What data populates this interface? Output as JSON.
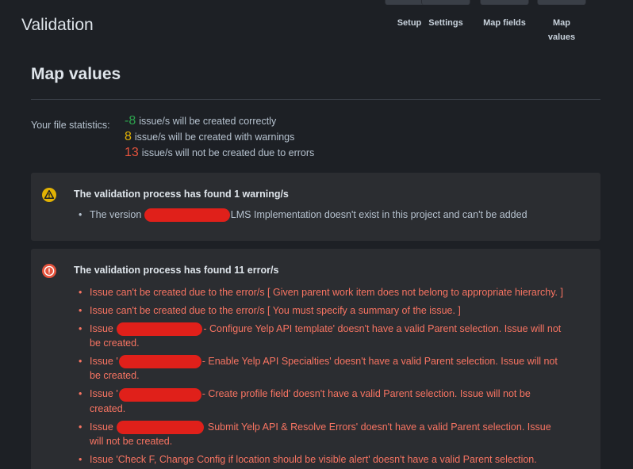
{
  "header": {
    "title": "Validation",
    "steps": [
      {
        "label": "Setup"
      },
      {
        "label": "Settings"
      },
      {
        "label": "Map fields"
      },
      {
        "label": "Map values"
      }
    ]
  },
  "section": {
    "title": "Map values"
  },
  "stats": {
    "label": "Your file statistics:",
    "correct_count": "-8",
    "correct_text": "issue/s will be created correctly",
    "warning_count": "8",
    "warning_text": "issue/s will be created with warnings",
    "error_count": "13",
    "error_text": "issue/s will not be created due to errors"
  },
  "warnings": {
    "title": "The validation process has found 1 warning/s",
    "items": [
      {
        "before": "The version",
        "after": "LMS Implementation doesn't exist in this project and can't be added"
      }
    ]
  },
  "errors": {
    "title": "The validation process has found 11 error/s",
    "items": [
      {
        "text": "Issue can't be created due to the error/s [ Given parent work item does not belong to appropriate hierarchy. ]"
      },
      {
        "text": "Issue can't be created due to the error/s [ You must specify a summary of the issue. ]"
      },
      {
        "before": "Issue",
        "after": "- Configure Yelp API template' doesn't have a valid Parent selection. Issue will not be created."
      },
      {
        "before": "Issue '",
        "after": "- Enable Yelp API Specialties' doesn't have a valid Parent selection. Issue will not be created."
      },
      {
        "before": "Issue '",
        "after": "- Create profile field' doesn't have a valid Parent selection. Issue will not be created."
      },
      {
        "before": "Issue",
        "after": "Submit Yelp API & Resolve Errors' doesn't have a valid Parent selection. Issue will not be created."
      },
      {
        "text": "Issue 'Check F, Change Config if location should be visible alert' doesn't have a valid Parent selection."
      }
    ]
  },
  "colors": {
    "background": "#1d2025",
    "panel": "#2b2d31",
    "ok": "#2da44e",
    "warning": "#e2b203",
    "error": "#e5533d",
    "error_text": "#f87462",
    "redaction": "#e0201a"
  },
  "icons": {
    "warning": "warning-triangle-icon",
    "error": "error-circle-icon"
  }
}
